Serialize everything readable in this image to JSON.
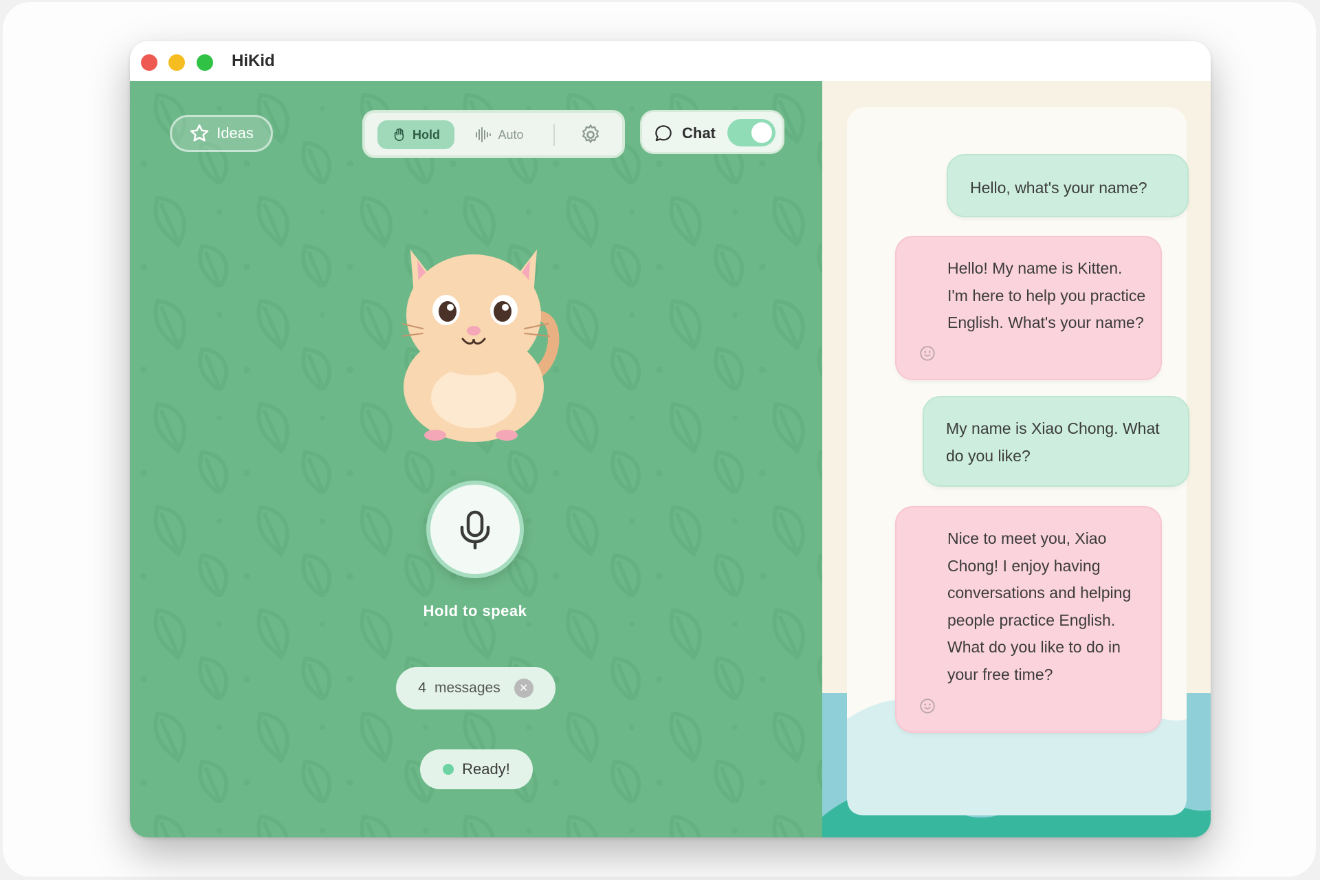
{
  "window": {
    "title": "HiKid"
  },
  "toolbar": {
    "ideas_label": "Ideas",
    "hold_label": "Hold",
    "auto_label": "Auto",
    "chat_label": "Chat",
    "chat_toggle_on": true
  },
  "main": {
    "hold_to_speak": "Hold to speak",
    "message_count": "4",
    "message_count_label": "messages",
    "status": "Ready!"
  },
  "messages": [
    {
      "role": "user",
      "text": "Hello, what's your name?"
    },
    {
      "role": "bot",
      "text": "Hello! My name is Kitten. I'm here to help you practice English. What's your name?"
    },
    {
      "role": "user",
      "text": "My name is Xiao Chong. What do you like?"
    },
    {
      "role": "bot",
      "text": "Nice to meet you, Xiao Chong! I enjoy having conversations and helping people practice English. What do you like to do in your free time?"
    }
  ],
  "colors": {
    "left_panel_bg": "#6db888",
    "user_bubble": "#cdeedf",
    "bot_bubble": "#fbd3dd",
    "accent_toggle": "#8fdcb7"
  },
  "icons": [
    "star-icon",
    "hand-icon",
    "waveform-icon",
    "gear-icon",
    "chat-bubble-icon",
    "microphone-icon",
    "close-icon",
    "smiley-icon"
  ]
}
